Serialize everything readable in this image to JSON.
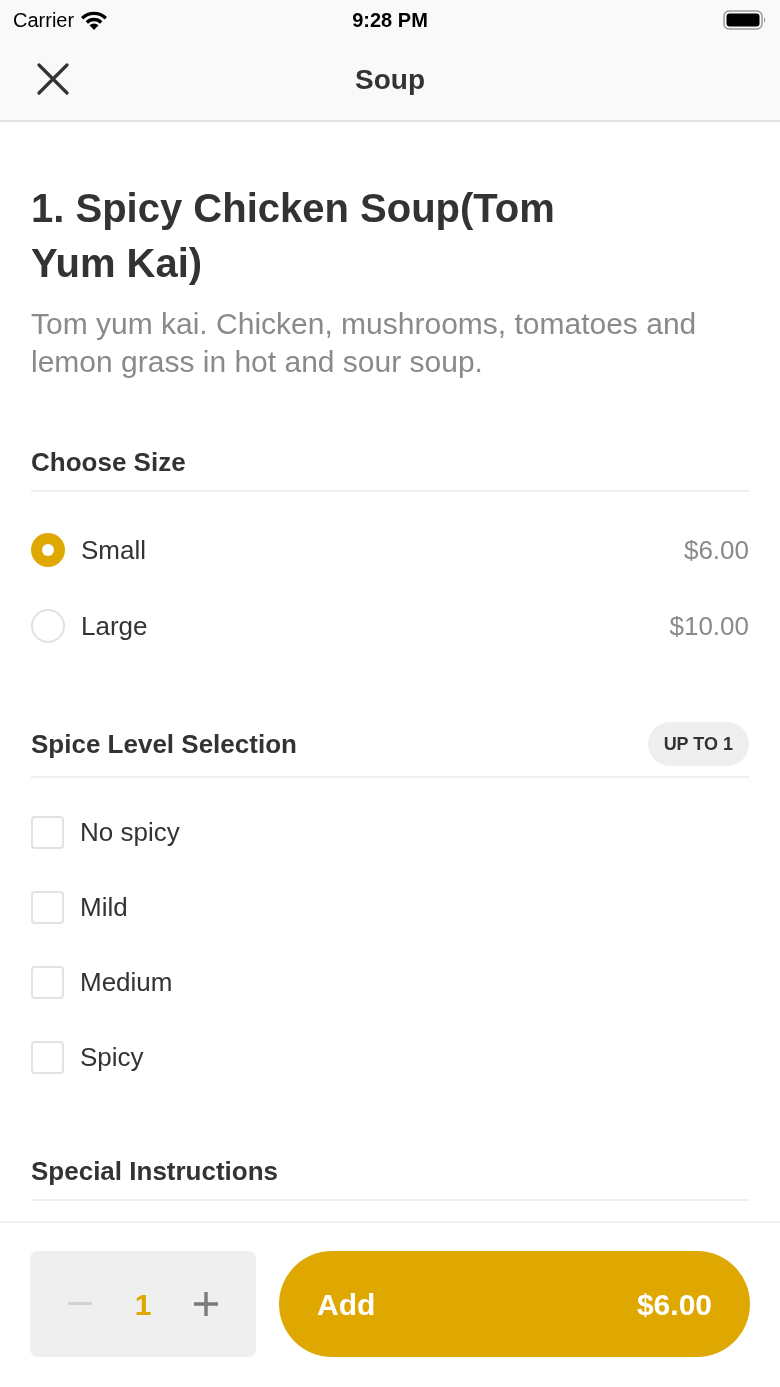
{
  "status_bar": {
    "carrier": "Carrier",
    "time": "9:28 PM"
  },
  "nav": {
    "title": "Soup"
  },
  "item": {
    "title": "1. Spicy Chicken Soup(Tom Yum Kai)",
    "description": "Tom yum kai. Chicken, mushrooms, tomatoes and lemon grass in hot and sour soup."
  },
  "sections": [
    {
      "kind": "radio",
      "title": "Choose Size",
      "options": [
        {
          "label": "Small",
          "price": "$6.00",
          "selected": true
        },
        {
          "label": "Large",
          "price": "$10.00",
          "selected": false
        }
      ]
    },
    {
      "kind": "checkbox",
      "title": "Spice Level Selection",
      "badge": "UP TO 1",
      "options": [
        {
          "label": "No spicy",
          "checked": false
        },
        {
          "label": "Mild",
          "checked": false
        },
        {
          "label": "Medium",
          "checked": false
        },
        {
          "label": "Spicy",
          "checked": false
        }
      ]
    },
    {
      "kind": "text",
      "title": "Special Instructions"
    }
  ],
  "footer": {
    "quantity": "1",
    "decrement_disabled": true,
    "add_button": {
      "label": "Add",
      "price": "$6.00"
    }
  }
}
